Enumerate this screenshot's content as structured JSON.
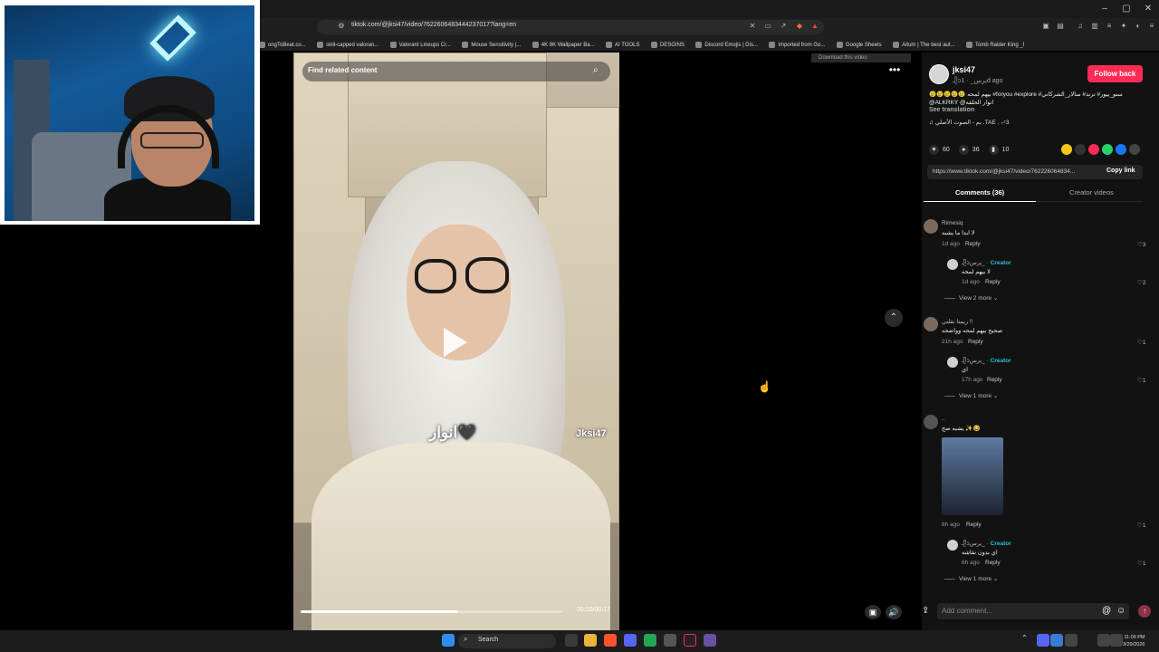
{
  "browser": {
    "url": "tiktok.com/@jksi47/video/7622606483444237017?lang=en",
    "bookmarks": [
      "ongToBeat.co...",
      "skill-capped valoran...",
      "Valorant Lineups Cr...",
      "Mouse Sensitivity |...",
      "4K 8K Wallpaper Ba...",
      "AI TOOLS",
      "DESGINS",
      "Discord Emojis | Dis...",
      "Imported from Go...",
      "Google Sheets",
      "Aitum | The best aut...",
      "Tomb Raider King _I"
    ],
    "window_controls": [
      "–",
      "▢",
      "✕"
    ]
  },
  "video": {
    "search_placeholder": "Find related content",
    "overlay_text": "انوار🖤",
    "watermark": "Jksi47",
    "time": "00:10/00:17",
    "progress": 0.6,
    "download_label": "Download this video"
  },
  "post": {
    "author": "jksi47",
    "author_sub": "ـᥫᩣيرس_ · 1d ago",
    "follow_label": "Follow back",
    "caption": "😢😢😢😢😢 بيهم لمحه #foryou #explore #ستو_بيور# ترند# سالار_الشركاني @ALKRKY @انوار الحلقه",
    "see_translation": "See translation",
    "music": "♫ بم - الصوت الأصلي .TAE . ₊ᶜ3",
    "likes": "60",
    "comments_count": "36",
    "saves": "10",
    "link": "https://www.tiktok.com/@jksi47/video/762226064834...",
    "copy_link": "Copy link",
    "tab_comments": "Comments (36)",
    "tab_creator": "Creator videos"
  },
  "comments": [
    {
      "name": "Rimesiq",
      "text": "لا ابدا ما يشبه",
      "meta": "1d ago",
      "reply": "Reply",
      "likes": "3",
      "reply_item": {
        "name": "ـᥫᩣيرس_ ·",
        "creator": "Creator",
        "text": "لا بيهم لمحه",
        "meta": "1d ago",
        "reply": "Reply",
        "likes": "2"
      },
      "view_more": "View 2 more"
    },
    {
      "name": "ريمتا نقلني !!",
      "text": "صحيح بيهم لمحه وواضحه",
      "meta": "21h ago",
      "reply": "Reply",
      "likes": "1",
      "reply_item": {
        "name": "ـᥫᩣيرس_ ·",
        "creator": "Creator",
        "text": "اي",
        "meta": "17h ago",
        "reply": "Reply",
        "likes": "1"
      },
      "view_more": "View 1 more"
    },
    {
      "name": "..",
      "text": "يشبه صح ✨😂",
      "meta": "8h ago",
      "reply": "Reply",
      "likes": "1",
      "reply_item": {
        "name": "ـᥫᩣيرس_ ·",
        "creator": "Creator",
        "text": "اي بدون نقاشه",
        "meta": "6h ago",
        "reply": "Reply",
        "likes": "1"
      },
      "view_more": "View 1 more"
    }
  ],
  "composer": {
    "placeholder": "Add comment..."
  },
  "taskbar": {
    "search_label": "Search",
    "time": "11:09 PM",
    "date": "3/29/2026"
  },
  "colors": {
    "follow": "#fe2c55",
    "creator": "#25c2d6"
  }
}
